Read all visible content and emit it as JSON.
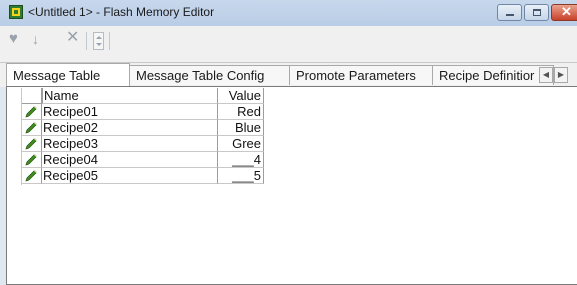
{
  "window": {
    "title": "<Untitled 1> - Flash Memory Editor"
  },
  "toolbar": {
    "icons": [
      "heart-icon",
      "arrow-down-icon",
      "eraser-icon",
      "delete-icon",
      "spinner-icon",
      "pin-icon"
    ]
  },
  "tabs": [
    {
      "label": "Message Table",
      "active": true
    },
    {
      "label": "Message Table Config",
      "active": false
    },
    {
      "label": "Promote Parameters",
      "active": false
    },
    {
      "label": "Recipe Definitior",
      "active": false
    }
  ],
  "table": {
    "columns": [
      "Name",
      "Value"
    ],
    "rows": [
      {
        "name": "Recipe01",
        "value": "Red"
      },
      {
        "name": "Recipe02",
        "value": "Blue"
      },
      {
        "name": "Recipe03",
        "value": "Gree"
      },
      {
        "name": "Recipe04",
        "value": "___4"
      },
      {
        "name": "Recipe05",
        "value": "___5"
      }
    ]
  },
  "colors": {
    "titlebar": "#c7d8ec",
    "close_button": "#c9412a",
    "pencil": "#3f8f1f"
  }
}
